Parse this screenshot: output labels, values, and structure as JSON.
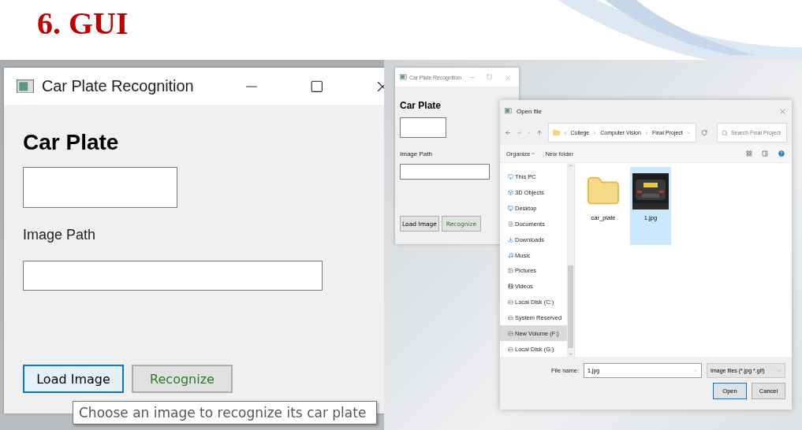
{
  "slide": {
    "title": "6. GUI"
  },
  "main_window": {
    "title": "Car Plate Recognition",
    "heading": "Car Plate",
    "field_label": "Image Path",
    "buttons": [
      {
        "label": "Load Image",
        "focused": true,
        "color": "#000000"
      },
      {
        "label": "Recognize",
        "focused": false,
        "color": "#2a7a2a"
      }
    ],
    "tooltip": "Choose an image to recognize its car plate"
  },
  "small_window": {
    "title": "Car Plate Recognition",
    "heading": "Car Plate",
    "field_label": "Image Path",
    "buttons": [
      {
        "label": "Load Image",
        "focused": false
      },
      {
        "label": "Recognize",
        "focused": false
      }
    ]
  },
  "open_dialog": {
    "title": "Open file",
    "breadcrumb": [
      "College",
      "Computer Vision",
      "Final Project"
    ],
    "search": {
      "placeholder": "Search Final Project"
    },
    "toolbar": [
      "Organize",
      "New folder"
    ],
    "nav_items": [
      {
        "label": "This PC",
        "kind": "pc",
        "selected": false
      },
      {
        "label": "3D Objects",
        "kind": "objects",
        "selected": false
      },
      {
        "label": "Desktop",
        "kind": "desktop",
        "selected": false
      },
      {
        "label": "Documents",
        "kind": "documents",
        "selected": false
      },
      {
        "label": "Downloads",
        "kind": "downloads",
        "selected": false
      },
      {
        "label": "Music",
        "kind": "music",
        "selected": false
      },
      {
        "label": "Pictures",
        "kind": "pictures",
        "selected": false
      },
      {
        "label": "Videos",
        "kind": "videos",
        "selected": false
      },
      {
        "label": "Local Disk (C:)",
        "kind": "drive",
        "selected": false
      },
      {
        "label": "System Reserved",
        "kind": "drive",
        "selected": false
      },
      {
        "label": "New Volume (F:)",
        "kind": "drive",
        "selected": true
      },
      {
        "label": "Local Disk (G:)",
        "kind": "drive",
        "selected": false
      }
    ],
    "files": [
      {
        "name": "car_plate",
        "kind": "folder",
        "selected": false
      },
      {
        "name": "1.jpg",
        "selected": true
      }
    ],
    "file_name": {
      "label": "File name:",
      "value": "1.jpg"
    },
    "file_type": "Image files (*.jpg *.gif)",
    "buttons": [
      {
        "label": "Open",
        "focused": true
      },
      {
        "label": "Cancel",
        "focused": false
      }
    ]
  }
}
